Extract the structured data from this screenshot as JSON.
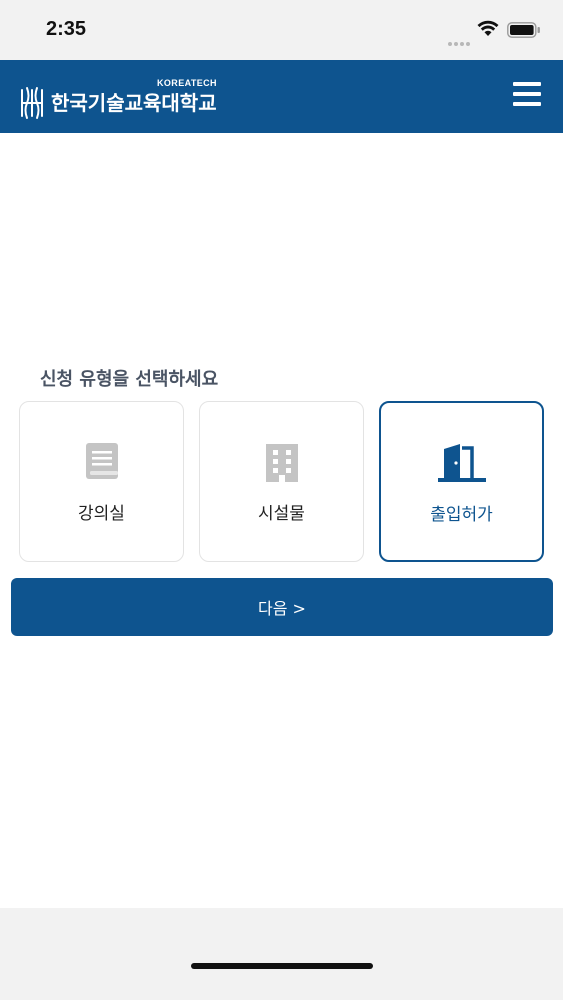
{
  "status_bar": {
    "time": "2:35"
  },
  "header": {
    "logo_text": "한국기술교육대학교",
    "logo_subtext": "KOREATECH",
    "menu_icon": "hamburger-menu-icon"
  },
  "main": {
    "prompt": "신청 유형을 선택하세요",
    "options": [
      {
        "label": "강의실",
        "icon": "book-icon",
        "selected": false
      },
      {
        "label": "시설물",
        "icon": "building-icon",
        "selected": false
      },
      {
        "label": "출입허가",
        "icon": "door-icon",
        "selected": true
      }
    ],
    "next_label": "다음 >"
  },
  "colors": {
    "brand": "#0e548f",
    "icon_inactive": "#c4c4c4",
    "prompt_text": "#4a5464"
  }
}
